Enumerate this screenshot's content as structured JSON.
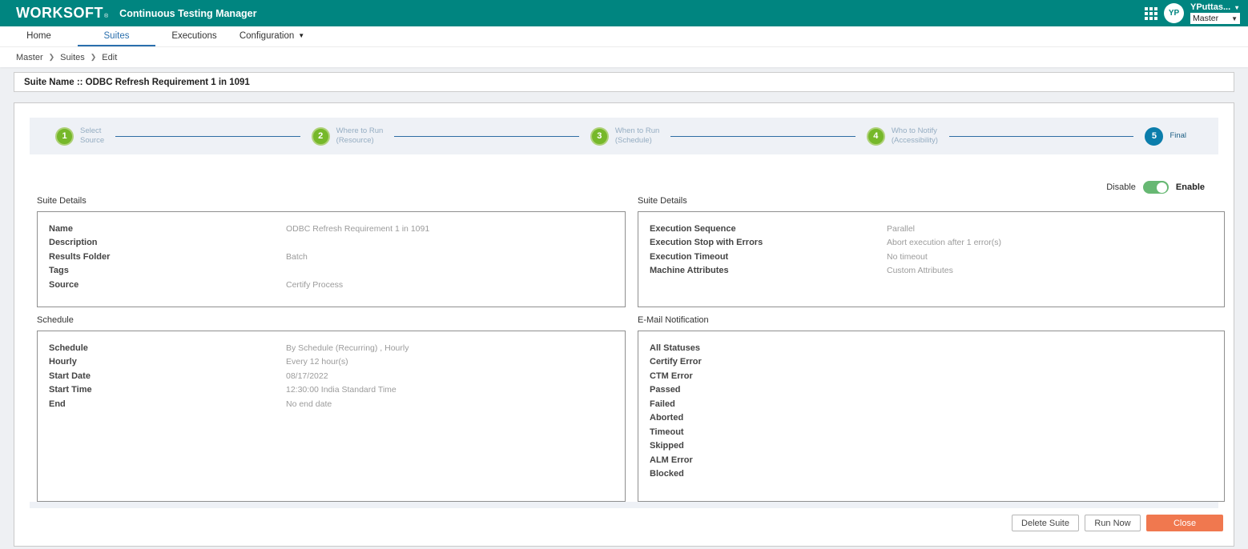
{
  "header": {
    "logo_text": "WORKSOFT",
    "logo_reg": "®",
    "app_title": "Continuous Testing Manager",
    "user_initials": "YP",
    "user_name": "YPuttas...",
    "user_caret": "▾",
    "tenant_value": "Master",
    "tenant_caret": "▼"
  },
  "nav": {
    "tabs": [
      {
        "label": "Home"
      },
      {
        "label": "Suites"
      },
      {
        "label": "Executions"
      },
      {
        "label": "Configuration"
      }
    ],
    "config_caret": "▼"
  },
  "breadcrumb": {
    "separator": "❯",
    "items": [
      "Master",
      "Suites",
      "Edit"
    ]
  },
  "suite_name_bar": "Suite Name :: ODBC Refresh Requirement 1 in 1091",
  "stepper": {
    "steps": [
      {
        "num": "1",
        "line1": "Select",
        "line2": "Source"
      },
      {
        "num": "2",
        "line1": "Where to Run",
        "line2": "(Resource)"
      },
      {
        "num": "3",
        "line1": "When to Run",
        "line2": "(Schedule)"
      },
      {
        "num": "4",
        "line1": "Who to Notify",
        "line2": "(Accessibility)"
      },
      {
        "num": "5",
        "line1": "Final",
        "line2": ""
      }
    ]
  },
  "toggle": {
    "off_label": "Disable",
    "on_label": "Enable",
    "state": "on"
  },
  "panels": {
    "suite_details_left": {
      "title": "Suite Details",
      "rows": [
        {
          "label": "Name",
          "value": "ODBC Refresh Requirement 1 in 1091"
        },
        {
          "label": "Description",
          "value": ""
        },
        {
          "label": "Results Folder",
          "value": "Batch"
        },
        {
          "label": "Tags",
          "value": ""
        },
        {
          "label": "Source",
          "value": "Certify Process"
        }
      ]
    },
    "suite_details_right": {
      "title": "Suite Details",
      "rows": [
        {
          "label": "Execution Sequence",
          "value": "Parallel"
        },
        {
          "label": "Execution Stop with Errors",
          "value": "Abort execution after 1 error(s)"
        },
        {
          "label": "Execution Timeout",
          "value": "No timeout"
        },
        {
          "label": "Machine Attributes",
          "value": "Custom Attributes"
        }
      ]
    },
    "schedule": {
      "title": "Schedule",
      "rows": [
        {
          "label": "Schedule",
          "value": "By Schedule (Recurring) , Hourly"
        },
        {
          "label": "Hourly",
          "value": "Every 12 hour(s)"
        },
        {
          "label": "Start Date",
          "value": "08/17/2022"
        },
        {
          "label": "Start Time",
          "value": "12:30:00 India Standard Time"
        },
        {
          "label": "End",
          "value": "No end date"
        }
      ]
    },
    "email_notification": {
      "title": "E-Mail Notification",
      "items": [
        "All Statuses",
        "Certify Error",
        "CTM Error",
        "Passed",
        "Failed",
        "Aborted",
        "Timeout",
        "Skipped",
        "ALM Error",
        "Blocked"
      ]
    }
  },
  "footer": {
    "delete_label": "Delete Suite",
    "run_label": "Run Now",
    "close_label": "Close"
  },
  "colors": {
    "header_teal": "#008580",
    "accent_blue": "#2a6fad",
    "step_green": "#76b82a",
    "step_blue": "#0b7dab",
    "toggle_green": "#67b873",
    "close_orange": "#f0784f"
  }
}
